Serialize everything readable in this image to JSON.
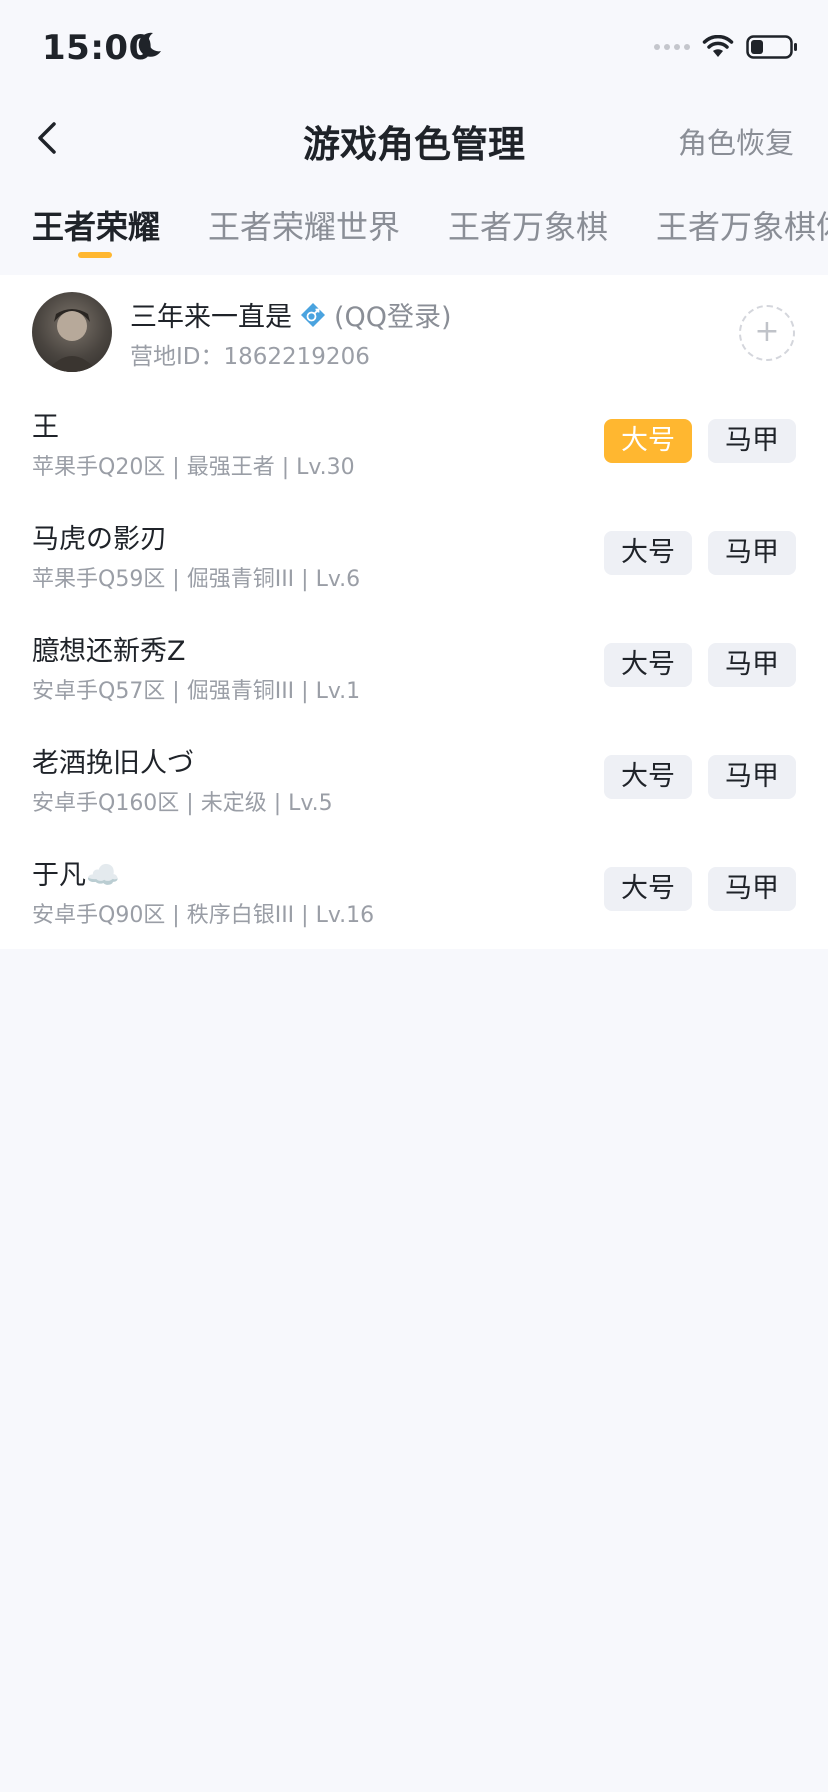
{
  "status": {
    "time": "15:00"
  },
  "nav": {
    "title": "游戏角色管理",
    "restore_label": "角色恢复"
  },
  "tabs": [
    {
      "label": "王者荣耀",
      "active": true
    },
    {
      "label": "王者荣耀世界",
      "active": false
    },
    {
      "label": "王者万象棋",
      "active": false
    },
    {
      "label": "王者万象棋体",
      "active": false
    }
  ],
  "profile": {
    "name": "三年来一直是",
    "login": "(QQ登录)",
    "camp_id_label": "营地ID：",
    "camp_id": "1862219206",
    "add_label": "+"
  },
  "roles": [
    {
      "name": "王",
      "info": "苹果手Q20区 | 最强王者 | Lv.30",
      "main_label": "大号",
      "alt_label": "马甲",
      "is_main": true
    },
    {
      "name": "马虎の影刃",
      "info": "苹果手Q59区 | 倔强青铜III | Lv.6",
      "main_label": "大号",
      "alt_label": "马甲",
      "is_main": false
    },
    {
      "name": "臆想还新秀Z",
      "info": "安卓手Q57区 | 倔强青铜III | Lv.1",
      "main_label": "大号",
      "alt_label": "马甲",
      "is_main": false
    },
    {
      "name": "老酒挽旧人づ",
      "info": "安卓手Q160区 | 未定级 | Lv.5",
      "main_label": "大号",
      "alt_label": "马甲",
      "is_main": false
    },
    {
      "name": "于凡☁️",
      "info": "安卓手Q90区 | 秩序白银III | Lv.16",
      "main_label": "大号",
      "alt_label": "马甲",
      "is_main": false
    }
  ],
  "colors": {
    "accent": "#ffb730",
    "background": "#f7f8fc",
    "tag_bg": "#eef0f5",
    "muted_text": "#9a9ea6"
  }
}
